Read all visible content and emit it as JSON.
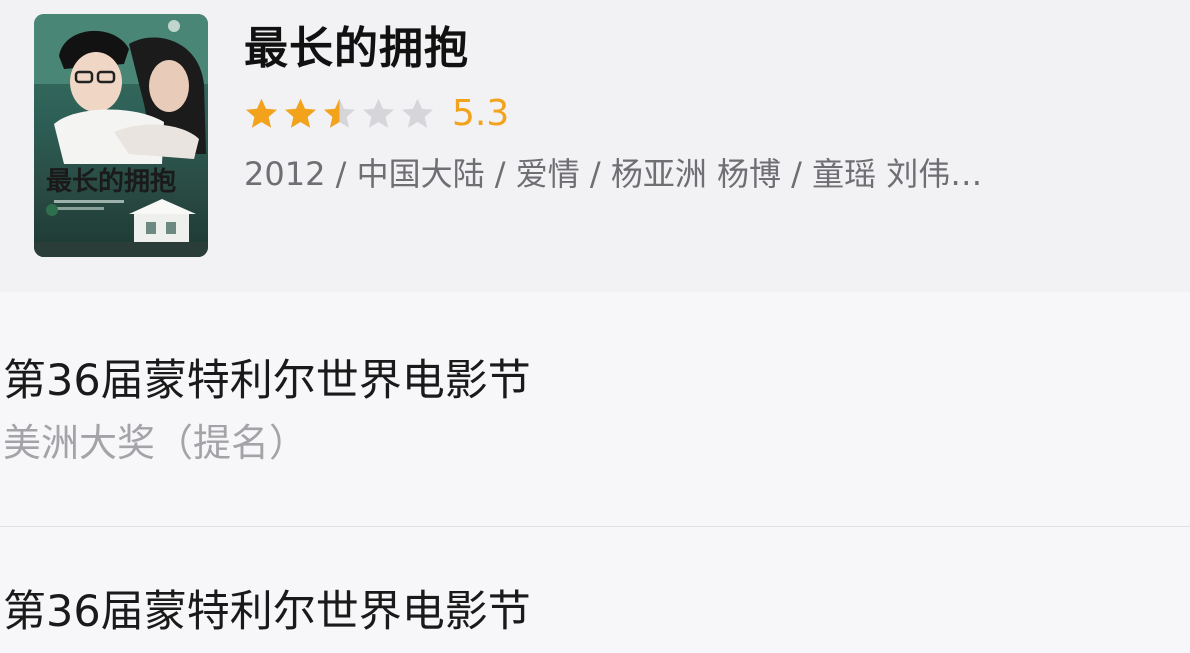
{
  "movie": {
    "title": "最长的拥抱",
    "rating": {
      "score": "5.3",
      "stars_filled": 2.5,
      "stars_total": 5,
      "color": "#f2a21b",
      "empty_color": "#d5d5da"
    },
    "meta": "2012 / 中国大陆 / 爱情 / 杨亚洲 杨博 / 童瑶 刘伟…",
    "poster": {
      "icon": "movie-poster-image",
      "title_text": "最长的拥抱"
    }
  },
  "awards": [
    {
      "festival": "第36届蒙特利尔世界电影节",
      "category": "美洲大奖（提名）"
    },
    {
      "festival": "第36届蒙特利尔世界电影节"
    }
  ]
}
